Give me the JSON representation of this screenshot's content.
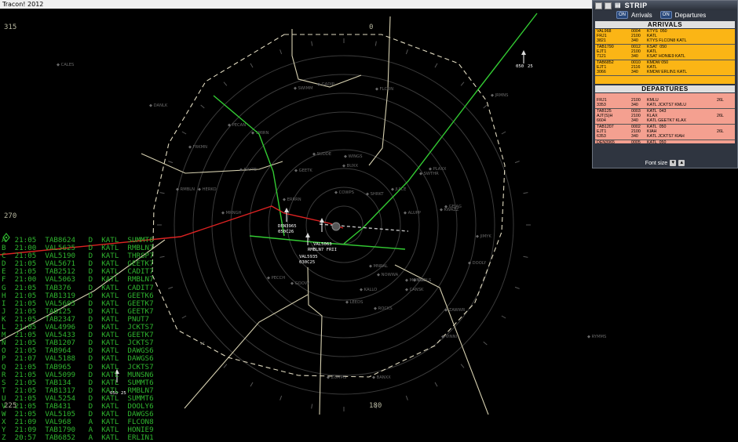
{
  "window": {
    "title": "Tracon! 2012",
    "controls": [
      "–",
      "□",
      "✕"
    ]
  },
  "bearings": {
    "b0": "0",
    "b315": "315",
    "b270": "270",
    "b225": "225",
    "b180": "180"
  },
  "aircraft_tags": [
    {
      "callsign": "DEN3965",
      "data": "050C26"
    },
    {
      "callsign": "VAL5063",
      "data": "RMBLN7 FRII"
    },
    {
      "callsign": "VAL5935",
      "data": "030C25"
    },
    {
      "callsign": "050",
      "data": "25"
    },
    {
      "callsign": "050",
      "data": "25"
    }
  ],
  "fixes": [
    "CALES",
    "DANLK",
    "SWIMM",
    "GADIP",
    "FLCON",
    "JRMNS",
    "FRKMN",
    "BAYTE",
    "PECAN",
    "HERKO",
    "RMBLN",
    "MRNGH",
    "GEETK",
    "ERRRN",
    "WINGS",
    "COWPS",
    "SHRKT",
    "SWTHR",
    "ALUPP",
    "GEJAG",
    "JIMYK",
    "DOOLY",
    "MONKK",
    "NOWWA",
    "MNRAL",
    "KALLO",
    "LEEDS",
    "ZAWWR",
    "VINNI",
    "ROCKS",
    "ZUMMS",
    "BANXX",
    "CANSK",
    "CNDLS",
    "KWAZZ",
    "PLAXX",
    "JUICE",
    "SUDDE",
    "BUXX",
    "PECCH",
    "GOOVY",
    "RYMMS",
    "SMIRN"
  ],
  "traffic_list": [
    "A  21:05  TAB8624   D  KATL  SUMMT6",
    "B  21:00  VAL5625   D  KATL  RMBLN7",
    "C  21:05  VAL5190   D  KATL  THRSP7",
    "D  21:05  VAL5671   D  KATL  GEETK7",
    "E  21:05  TAB2512   D  KATL  CADIT7",
    "F  21:00  VAL5063   D  KATL  RMBLN7",
    "G  21:05  TAB376    D  KATL  CADIT7",
    "H  21:05  TAB1319   D  KATL  GEETK6",
    "I  21:05  VAL5605   D  KATL  GEETK7",
    "J  21:05  TAB125    D  KATL  GEETK7",
    "K  21:05  TAB2347   D  KATL  PNUT7",
    "L  21:05  VAL4996   D  KATL  JCKTS7",
    "M  21:05  VAL5433   D  KATL  GEETK7",
    "N  21:05  TAB1207   D  KATL  JCKTS7",
    "O  21:05  TAB964    D  KATL  DAWGS6",
    "P  21:07  VAL5188   D  KATL  DAWGS6",
    "Q  21:05  TAB965    D  KATL  JCKTS7",
    "R  21:05  VAL5099   D  KATL  MUNSN6",
    "S  21:05  TAB134    D  KATL  SUMMT6",
    "T  21:05  TAB1317   D  KATL  RMBLN7",
    "U  21:05  VAL5254   D  KATL  SUMMT6",
    "V  21:05  TAB431    D  KATL  DOOLY6",
    "W  21:05  VAL5105   D  KATL  DAWGS6",
    "X  21:09  VAL968    A  KATL  FLCON8",
    "Y  21:09  TAB1790   A  KATL  HONIE9",
    "Z  20:57  TAB6852   A  KATL  ERLIN1"
  ],
  "strip": {
    "title": "STRIP",
    "arrivals_tab": "Arrivals",
    "departures_tab": "Departures",
    "on_label": "ON",
    "arrivals_header": "ARRIVALS",
    "departures_header": "DEPARTURES",
    "font_size_label": "Font size",
    "arrivals": [
      {
        "c1": [
          "VAL968",
          "FRJ1",
          "3821"
        ],
        "c2": [
          "0004",
          "2100",
          "340"
        ],
        "c3": [
          "KTYS  050",
          "KATL",
          "KTYS FLCON8 KATL"
        ],
        "c4": []
      },
      {
        "c1": [
          "TAB1790",
          "EJT1",
          "7121"
        ],
        "c2": [
          "0012",
          "2100",
          "340"
        ],
        "c3": [
          "KSAT  050",
          "KATL",
          "KSAT HONIE9 KATL"
        ],
        "c4": []
      },
      {
        "c1": [
          "TAB6852",
          "EJT1",
          "3066"
        ],
        "c2": [
          "0010",
          "2116",
          "340"
        ],
        "c3": [
          "KMDW 050",
          "KATL",
          "KMDW ERLIN1 KATL"
        ],
        "c4": []
      }
    ],
    "departures": [
      {
        "c1": [
          "",
          "FRJ1",
          "3353"
        ],
        "c2": [
          "",
          "2100",
          "340"
        ],
        "c3": [
          "",
          "KMLU",
          "KATL JCKTS7 KMLU"
        ],
        "c4": [
          "",
          "26L",
          ""
        ]
      },
      {
        "c1": [
          "TAB125",
          "AJT(S)H",
          "6604"
        ],
        "c2": [
          "0003",
          "2100",
          "340"
        ],
        "c3": [
          "KATL  043",
          "KLAX",
          "KATL GEETK7 KLAX"
        ],
        "c4": [
          "",
          "26L",
          ""
        ]
      },
      {
        "c1": [
          "TAB1207",
          "EJT1",
          "6353"
        ],
        "c2": [
          "0002",
          "2100",
          "340"
        ],
        "c3": [
          "KATL  050",
          "KIAH",
          "KATL JCKTS7 KIAH"
        ],
        "c4": [
          "",
          "26L",
          ""
        ]
      },
      {
        "c1": [
          "DEN3965",
          "FRJ1",
          "1716"
        ],
        "c2": [
          "0005",
          "2100",
          "340"
        ],
        "c3": [
          "KATL  050",
          "KHOU",
          ""
        ],
        "c4": [
          "",
          "26L",
          ""
        ]
      }
    ]
  },
  "colors": {
    "scope": "#000000",
    "rings": "#3c3c3c",
    "boundary": "#d6d0b0",
    "green_route": "#33cc33",
    "red_route": "#dd2222",
    "traffic_text": "#2fb52f",
    "arrivals_bg": "#fbb515",
    "departures_bg": "#f4a090"
  }
}
